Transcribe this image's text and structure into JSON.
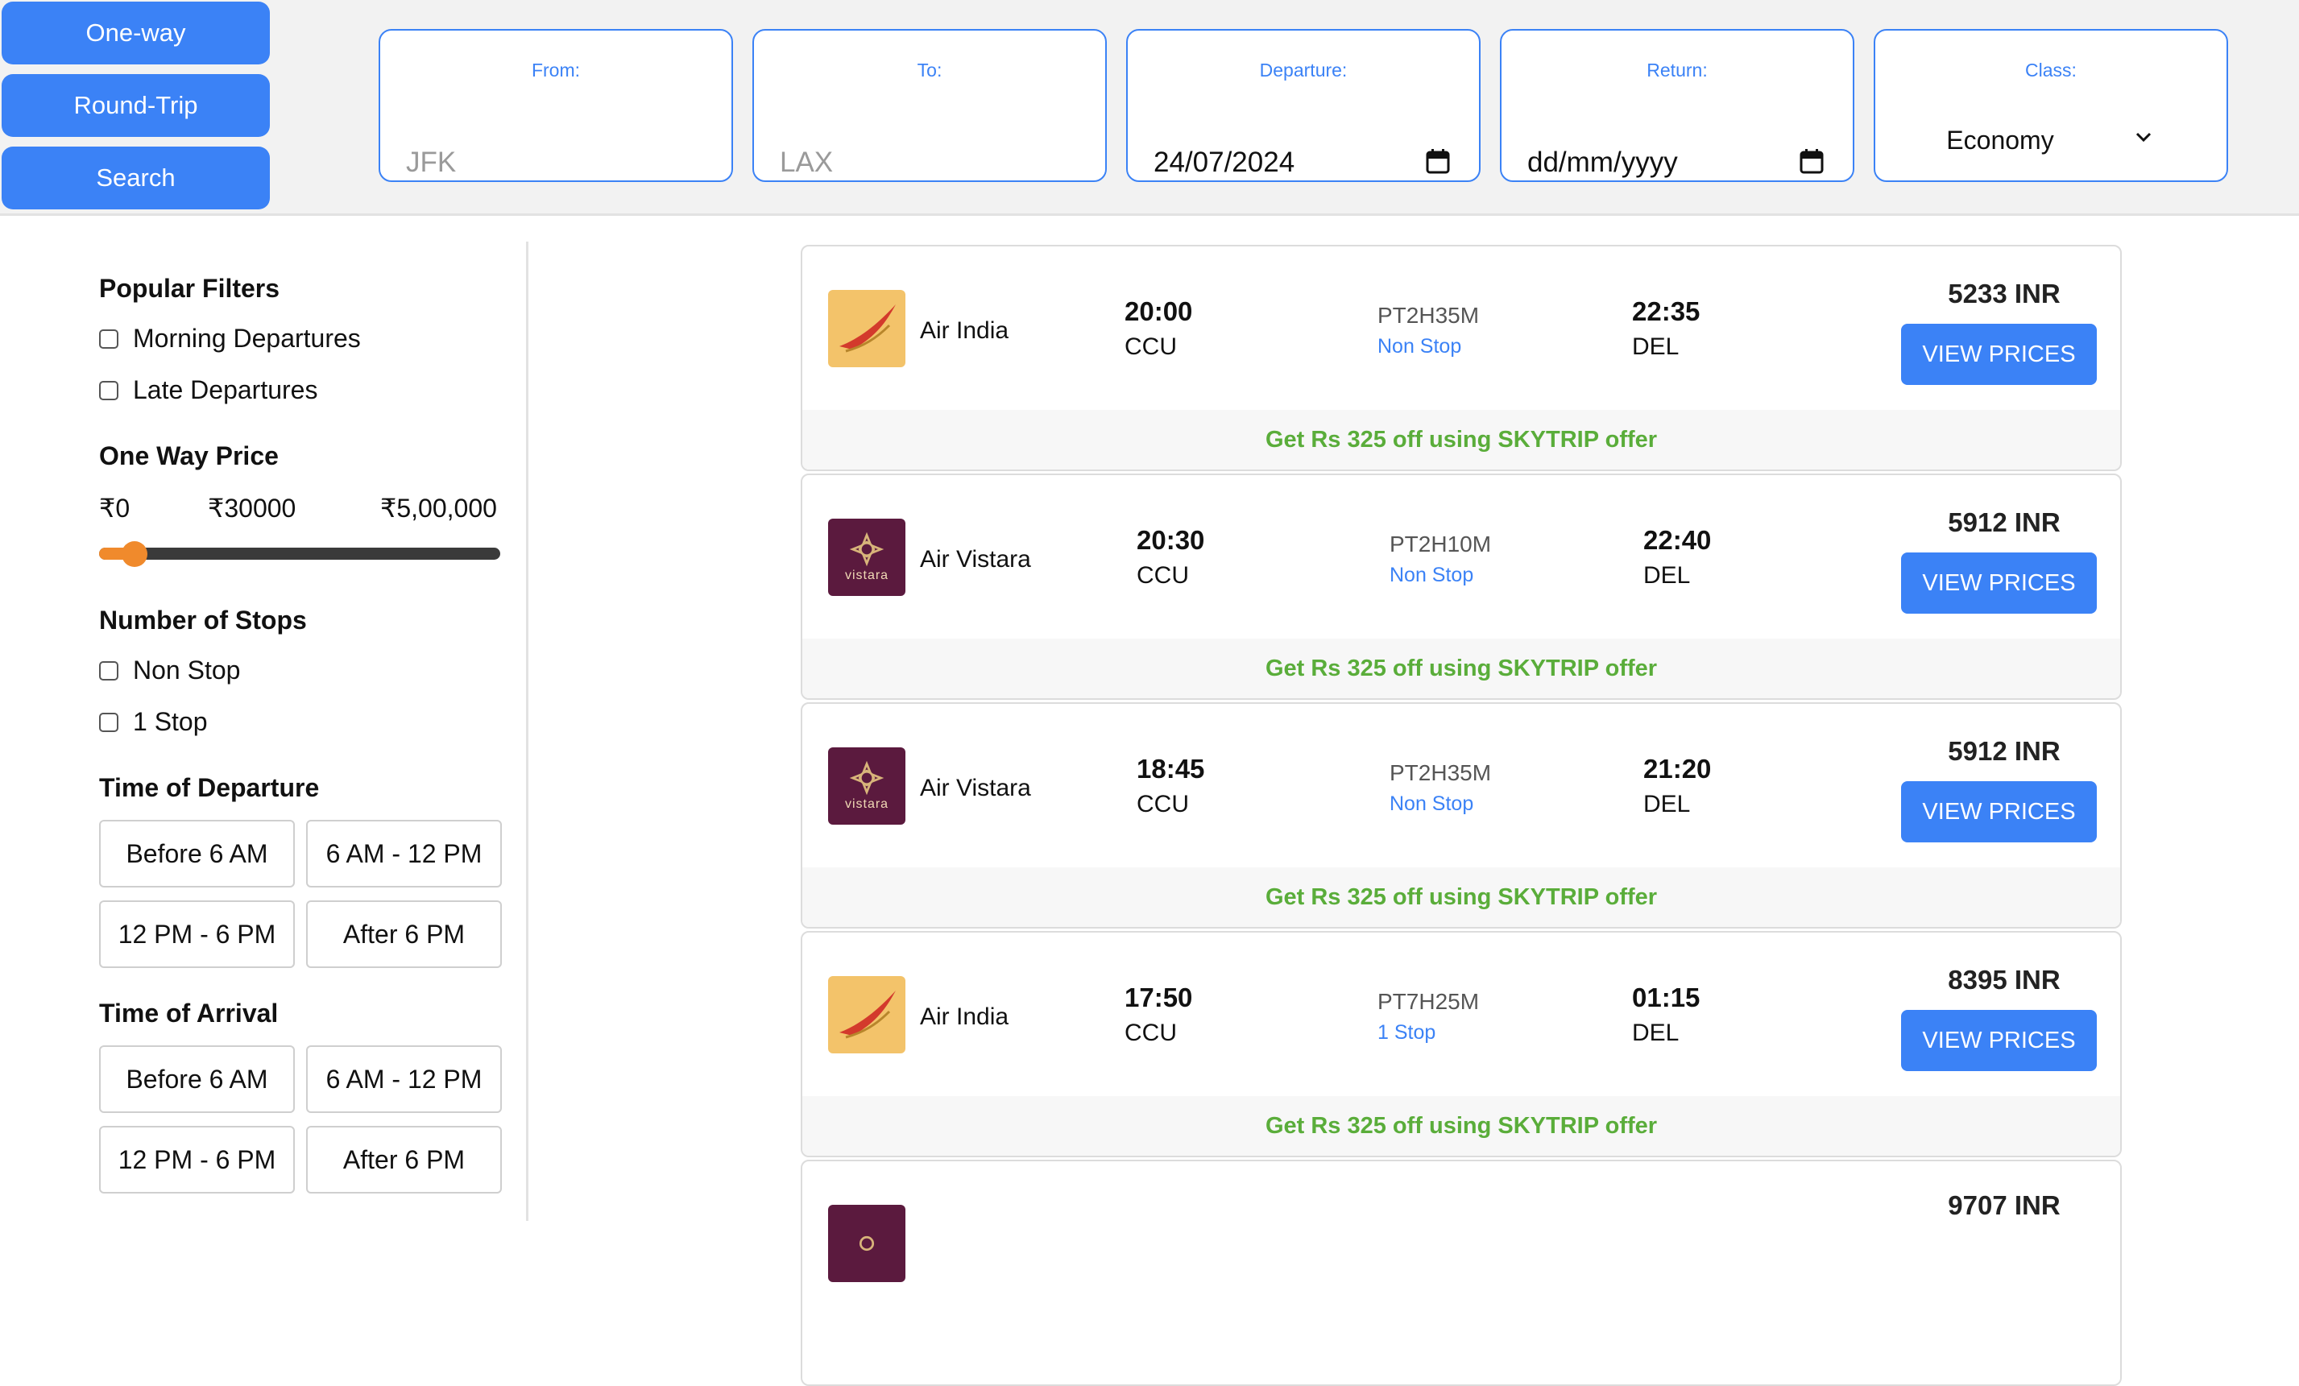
{
  "trip_types": [
    "One-way",
    "Round-Trip",
    "Search"
  ],
  "search": {
    "from": {
      "label": "From:",
      "placeholder": "JFK"
    },
    "to": {
      "label": "To:",
      "placeholder": "LAX"
    },
    "departure": {
      "label": "Departure:",
      "value": "24/07/2024"
    },
    "return": {
      "label": "Return:",
      "value": "dd/mm/yyyy"
    },
    "class": {
      "label": "Class:",
      "value": "Economy"
    }
  },
  "filters": {
    "popular_title": "Popular Filters",
    "popular": [
      "Morning Departures",
      "Late Departures"
    ],
    "price_title": "One Way Price",
    "price_min": "₹0",
    "price_current": "₹30000",
    "price_max": "₹5,00,000",
    "price_slider_fraction": 0.06,
    "stops_title": "Number of Stops",
    "stops": [
      "Non Stop",
      "1 Stop"
    ],
    "departure_title": "Time of Departure",
    "arrival_title": "Time of Arrival",
    "time_slots": [
      "Before 6 AM",
      "6 AM - 12 PM",
      "12 PM - 6 PM",
      "After 6 PM"
    ]
  },
  "flights": [
    {
      "airline": "Air India",
      "logo": "air-india",
      "dep_time": "20:00",
      "dep_city": "CCU",
      "duration": "PT2H35M",
      "stops": "Non Stop",
      "arr_time": "22:35",
      "arr_city": "DEL",
      "price": "5233 INR",
      "button": "VIEW PRICES",
      "offer": "Get Rs 325 off using SKYTRIP offer"
    },
    {
      "airline": "Air Vistara",
      "logo": "vistara",
      "dep_time": "20:30",
      "dep_city": "CCU",
      "duration": "PT2H10M",
      "stops": "Non Stop",
      "arr_time": "22:40",
      "arr_city": "DEL",
      "price": "5912 INR",
      "button": "VIEW PRICES",
      "offer": "Get Rs 325 off using SKYTRIP offer"
    },
    {
      "airline": "Air Vistara",
      "logo": "vistara",
      "dep_time": "18:45",
      "dep_city": "CCU",
      "duration": "PT2H35M",
      "stops": "Non Stop",
      "arr_time": "21:20",
      "arr_city": "DEL",
      "price": "5912 INR",
      "button": "VIEW PRICES",
      "offer": "Get Rs 325 off using SKYTRIP offer"
    },
    {
      "airline": "Air India",
      "logo": "air-india",
      "dep_time": "17:50",
      "dep_city": "CCU",
      "duration": "PT7H25M",
      "stops": "1 Stop",
      "arr_time": "01:15",
      "arr_city": "DEL",
      "price": "8395 INR",
      "button": "VIEW PRICES",
      "offer": "Get Rs 325 off using SKYTRIP offer"
    },
    {
      "airline": "",
      "logo": "vistara",
      "dep_time": "",
      "dep_city": "",
      "duration": "",
      "stops": "",
      "arr_time": "",
      "arr_city": "",
      "price": "9707 INR",
      "button": "",
      "offer": ""
    }
  ],
  "colors": {
    "accent": "#3b82f6",
    "offer": "#5aad3a",
    "slider": "#f08a2c"
  }
}
